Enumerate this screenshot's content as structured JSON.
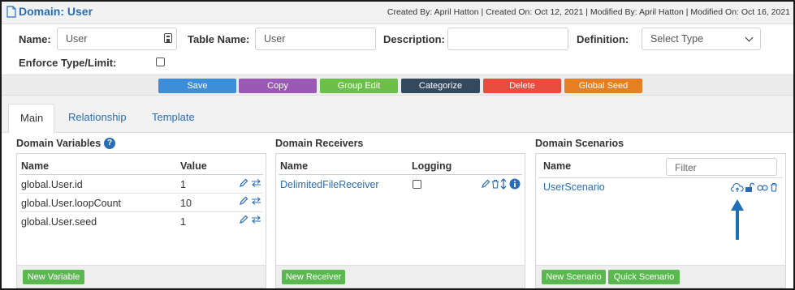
{
  "header": {
    "title": "Domain: User",
    "meta": "Created By: April Hatton | Created On: Oct 12, 2021 | Modified By: April Hatton | Modified On: Oct 16, 2021"
  },
  "form": {
    "name_label": "Name:",
    "name_value": "User",
    "table_name_label": "Table Name:",
    "table_name_value": "User",
    "description_label": "Description:",
    "description_value": "",
    "definition_label": "Definition:",
    "definition_selected": "Select Type",
    "enforce_label": "Enforce Type/Limit:",
    "enforce_checked": false
  },
  "actions": [
    {
      "label": "Save",
      "color": "#3c8ed8"
    },
    {
      "label": "Copy",
      "color": "#9b59b6"
    },
    {
      "label": "Group Edit",
      "color": "#6cc04a"
    },
    {
      "label": "Categorize",
      "color": "#34495e"
    },
    {
      "label": "Delete",
      "color": "#e74c3c"
    },
    {
      "label": "Global Seed",
      "color": "#e67e22"
    }
  ],
  "tabs": [
    {
      "label": "Main",
      "active": true
    },
    {
      "label": "Relationship",
      "active": false
    },
    {
      "label": "Template",
      "active": false
    }
  ],
  "variables": {
    "title": "Domain Variables",
    "col_name": "Name",
    "col_value": "Value",
    "rows": [
      {
        "name": "global.User.id",
        "value": "1"
      },
      {
        "name": "global.User.loopCount",
        "value": "10"
      },
      {
        "name": "global.User.seed",
        "value": "1"
      }
    ],
    "new_button": "New Variable"
  },
  "receivers": {
    "title": "Domain Receivers",
    "col_name": "Name",
    "col_logging": "Logging",
    "rows": [
      {
        "name": "DelimitedFileReceiver",
        "logging": false
      }
    ],
    "new_button": "New Receiver"
  },
  "scenarios": {
    "title": "Domain Scenarios",
    "col_name": "Name",
    "filter_placeholder": "Filter",
    "rows": [
      {
        "name": "UserScenario"
      }
    ],
    "new_button": "New Scenario",
    "quick_button": "Quick Scenario"
  },
  "colors": {
    "accent": "#2a6db5",
    "annotation_arrow": "#1f6fb8",
    "green_button": "#59b94e"
  }
}
